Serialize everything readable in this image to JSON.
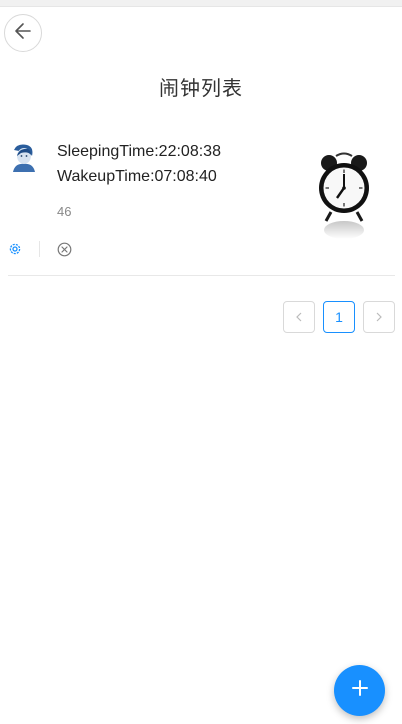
{
  "header": {
    "title": "闹钟列表",
    "back_icon": "arrow-left-icon"
  },
  "alarm_item": {
    "avatar_icon": "user-avatar",
    "sleeping_time": "SleepingTime:22:08:38",
    "wakeup_time": "WakeupTime:07:08:40",
    "count": "46",
    "image_icon": "alarm-clock-image",
    "actions": {
      "settings_icon": "gear-icon",
      "delete_icon": "close-circle-icon"
    }
  },
  "pagination": {
    "prev_icon": "chevron-left-icon",
    "current_page": "1",
    "next_icon": "chevron-right-icon"
  },
  "fab": {
    "icon": "plus-icon"
  },
  "colors": {
    "accent": "#1890ff",
    "divider": "#e8e8e8",
    "muted_text": "#888888"
  }
}
